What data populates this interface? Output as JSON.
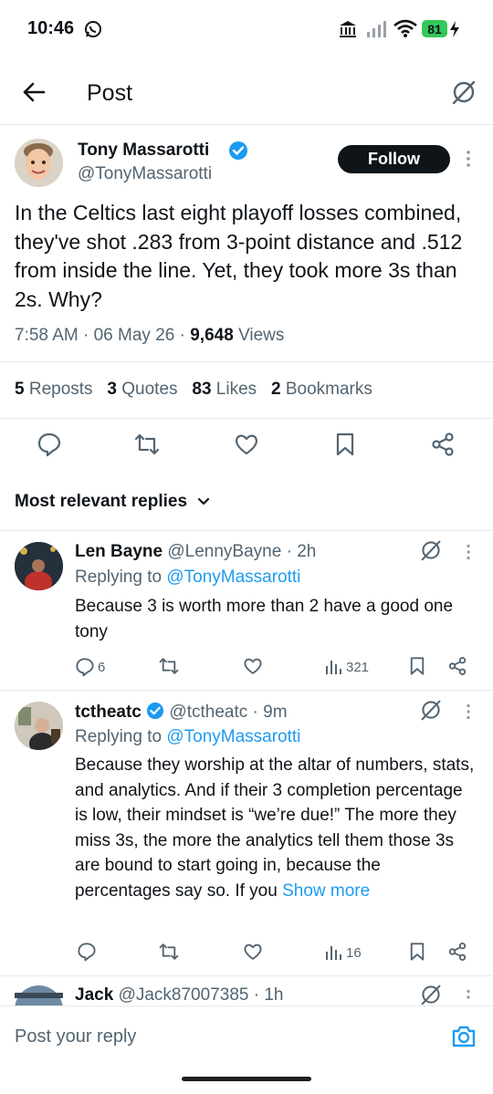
{
  "status_bar": {
    "time": "10:46",
    "battery": "81"
  },
  "header": {
    "title": "Post"
  },
  "post": {
    "author_name": "Tony Massarotti",
    "handle": "@TonyMassarotti",
    "follow_label": "Follow",
    "text": "In the Celtics last eight playoff losses combined, they've shot .283 from 3-point distance and .512 from inside the line. Yet, they took more 3s than 2s. Why?",
    "time": "7:58 AM",
    "date": "06 May 26",
    "views_count": "9,648",
    "views_label": "Views",
    "stats": {
      "reposts_count": "5",
      "reposts_label": "Reposts",
      "quotes_count": "3",
      "quotes_label": "Quotes",
      "likes_count": "83",
      "likes_label": "Likes",
      "bookmarks_count": "2",
      "bookmarks_label": "Bookmarks"
    }
  },
  "replies_header": "Most relevant replies",
  "replies": [
    {
      "name": "Len Bayne",
      "handle": "@LennyBayne",
      "time": "2h",
      "replying_prefix": "Replying to",
      "replying_to": "@TonyMassarotti",
      "text": "Because 3 is worth more than 2 have a good one tony",
      "reply_count": "6",
      "views": "321"
    },
    {
      "name": "tctheatc",
      "handle": "@tctheatc",
      "time": "9m",
      "replying_prefix": "Replying to",
      "replying_to": "@TonyMassarotti",
      "text": "Because they worship at the altar of numbers, stats, and analytics. And if their 3 completion percentage is low, their mindset is “we’re due!” The more they miss 3s, the more the analytics tell them those 3s are bound to start going in, because the percentages say so. If you",
      "show_more": "Show more",
      "views": "16"
    },
    {
      "name": "Jack",
      "handle": "@Jack87007385",
      "time": "1h"
    }
  ],
  "composer": {
    "placeholder": "Post your reply"
  },
  "colors": {
    "accent": "#1d9bf0",
    "verified": "#1d9bf0",
    "battery": "#34c759"
  }
}
